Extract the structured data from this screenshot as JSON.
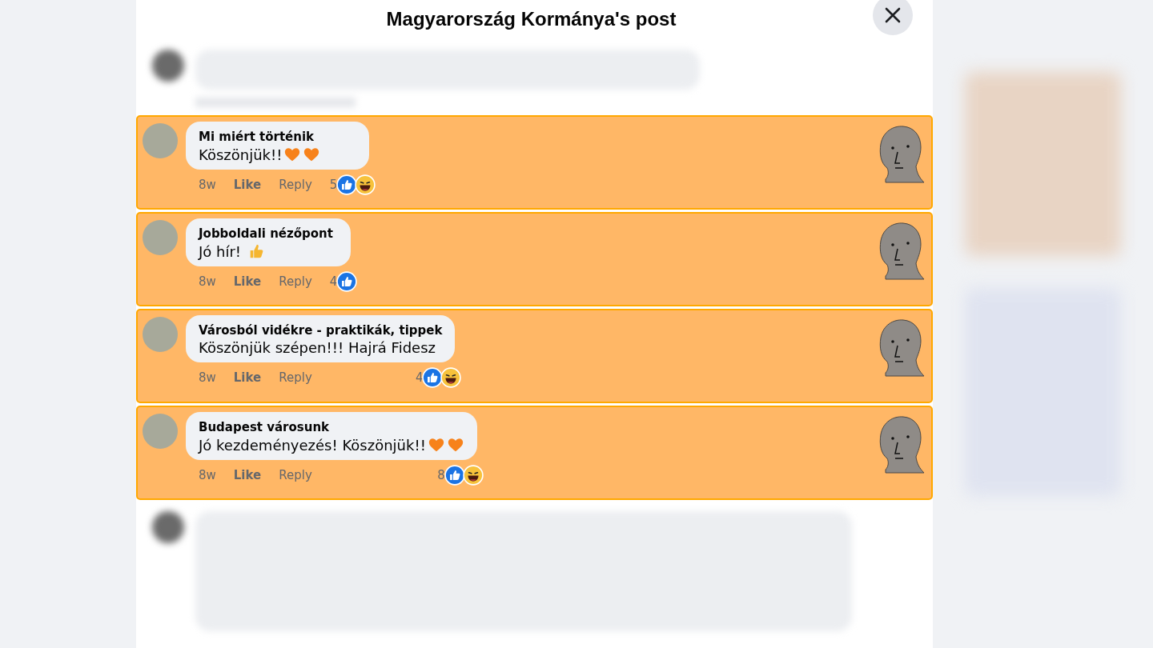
{
  "dialog": {
    "title": "Magyarország Kormánya's post"
  },
  "comments": [
    {
      "author": "Mi miért történik",
      "text": "Köszönjük!!",
      "emojis": [
        {
          "kind": "heart"
        },
        {
          "kind": "heart"
        }
      ],
      "time": "8w",
      "like": "Like",
      "reply": "Reply",
      "count": "5",
      "reactions": [
        {
          "kind": "like"
        },
        {
          "kind": "haha"
        }
      ]
    },
    {
      "author": "Jobboldali nézőpont",
      "text": "Jó hír! ",
      "emojis": [
        {
          "kind": "thumbs-up"
        }
      ],
      "time": "8w",
      "like": "Like",
      "reply": "Reply",
      "count": "4",
      "reactions": [
        {
          "kind": "like"
        }
      ]
    },
    {
      "author": "Városból vidékre - praktikák, tippek",
      "text": "Köszönjük szépen!!! Hajrá Fidesz",
      "time": "8w",
      "like": "Like",
      "reply": "Reply",
      "count": "4",
      "reactions": [
        {
          "kind": "like"
        },
        {
          "kind": "haha"
        }
      ]
    },
    {
      "author": "Budapest városunk",
      "text": "Jó kezdeményezés! Köszönjük!!",
      "emojis": [
        {
          "kind": "heart"
        },
        {
          "kind": "heart"
        }
      ],
      "time": "8w",
      "like": "Like",
      "reply": "Reply",
      "count": "8",
      "reactions": [
        {
          "kind": "like"
        },
        {
          "kind": "haha"
        }
      ]
    }
  ]
}
